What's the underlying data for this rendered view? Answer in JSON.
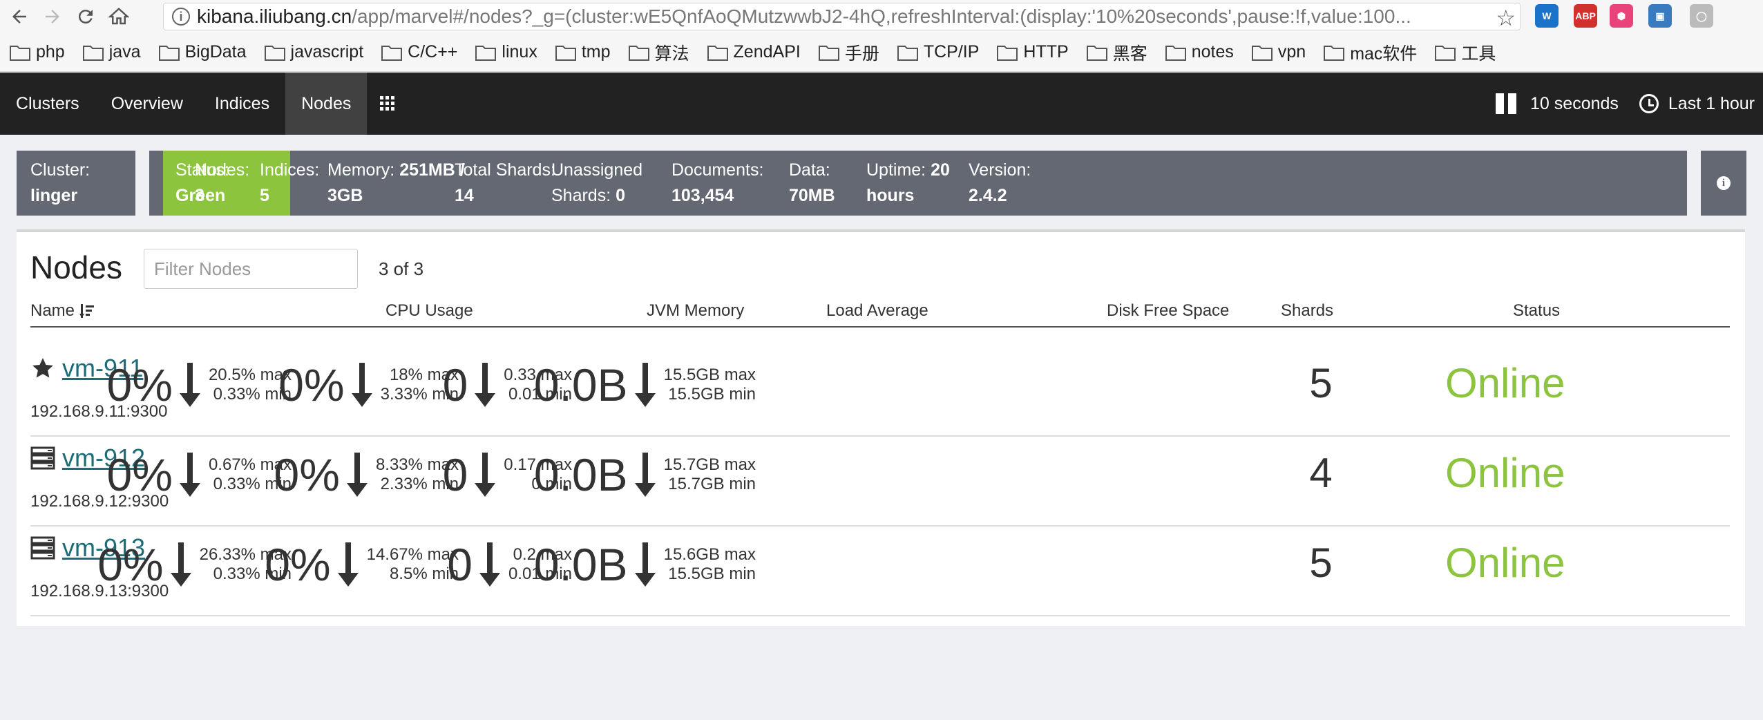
{
  "browser": {
    "url_domain": "kibana.iliubang.cn",
    "url_path": "/app/marvel#/nodes?_g=(cluster:wE5QnfAoQMutzwwbJ2-4hQ,refreshInterval:(display:'10%20seconds',pause:!f,value:100...",
    "extensions": [
      {
        "name": "w-extension-icon",
        "label": "W",
        "color": "#1a73c9"
      },
      {
        "name": "adblock-plus-icon",
        "label": "ABP",
        "color": "#d0312d"
      },
      {
        "name": "hexagon-extension-icon",
        "label": "⬢",
        "color": "#e8447a"
      },
      {
        "name": "image-extension-icon",
        "label": "▣",
        "color": "#3a7bbf"
      },
      {
        "name": "circle-extension-icon",
        "label": "◯",
        "color": "#bbbbbb"
      }
    ]
  },
  "bookmarks": [
    "php",
    "java",
    "BigData",
    "javascript",
    "C/C++",
    "linux",
    "tmp",
    "算法",
    "ZendAPI",
    "手册",
    "TCP/IP",
    "HTTP",
    "黑客",
    "notes",
    "vpn",
    "mac软件",
    "工具"
  ],
  "nav": {
    "tabs": [
      "Clusters",
      "Overview",
      "Indices",
      "Nodes"
    ],
    "active_tab": "Nodes",
    "refresh_label": "10 seconds",
    "time_label": "Last 1 hour"
  },
  "status": {
    "cluster_label": "Cluster:",
    "cluster_value": "linger",
    "status_label": "Status:",
    "status_value": "Green",
    "nodes_label": "Nodes:",
    "nodes_value": "3",
    "indices_label": "Indices:",
    "indices_value": "5",
    "memory_label": "Memory:",
    "memory_value_a": "251MB /",
    "memory_value_b": "3GB",
    "total_shards_label": "Total Shards:",
    "total_shards_value": "14",
    "unassigned_label": "Unassigned",
    "unassigned_label2": "Shards:",
    "unassigned_value": "0",
    "documents_label": "Documents:",
    "documents_value": "103,454",
    "data_label": "Data:",
    "data_value": "70MB",
    "uptime_label": "Uptime:",
    "uptime_value_a": "20",
    "uptime_value_b": "hours",
    "version_label": "Version:",
    "version_value": "2.4.2"
  },
  "panel": {
    "title": "Nodes",
    "filter_placeholder": "Filter Nodes",
    "count": "3 of 3",
    "columns": {
      "name": "Name",
      "cpu": "CPU Usage",
      "jvm": "JVM Memory",
      "load": "Load Average",
      "disk": "Disk Free Space",
      "shards": "Shards",
      "status": "Status"
    }
  },
  "nodes": [
    {
      "icon": "star-icon",
      "name": "vm-911",
      "address": "192.168.9.11:9300",
      "cpu": {
        "value": "0%",
        "max": "20.5% max",
        "min": "0.33% min"
      },
      "jvm": {
        "value": "0%",
        "max": "18% max",
        "min": "3.33% min"
      },
      "load": {
        "value": "0",
        "max": "0.33 max",
        "min": "0.01 min"
      },
      "disk": {
        "value": "0.0B",
        "max": "15.5GB max",
        "min": "15.5GB min"
      },
      "shards": "5",
      "status": "Online"
    },
    {
      "icon": "server-icon",
      "name": "vm-912",
      "address": "192.168.9.12:9300",
      "cpu": {
        "value": "0%",
        "max": "0.67% max",
        "min": "0.33% min"
      },
      "jvm": {
        "value": "0%",
        "max": "8.33% max",
        "min": "2.33% min"
      },
      "load": {
        "value": "0",
        "max": "0.17 max",
        "min": "0 min"
      },
      "disk": {
        "value": "0.0B",
        "max": "15.7GB max",
        "min": "15.7GB min"
      },
      "shards": "4",
      "status": "Online"
    },
    {
      "icon": "server-icon",
      "name": "vm-913",
      "address": "192.168.9.13:9300",
      "cpu": {
        "value": "0%",
        "max": "26.33% max",
        "min": "0.33% min"
      },
      "jvm": {
        "value": "0%",
        "max": "14.67% max",
        "min": "8.5% min"
      },
      "load": {
        "value": "0",
        "max": "0.2 max",
        "min": "0.01 min"
      },
      "disk": {
        "value": "0.0B",
        "max": "15.6GB max",
        "min": "15.5GB min"
      },
      "shards": "5",
      "status": "Online"
    }
  ]
}
